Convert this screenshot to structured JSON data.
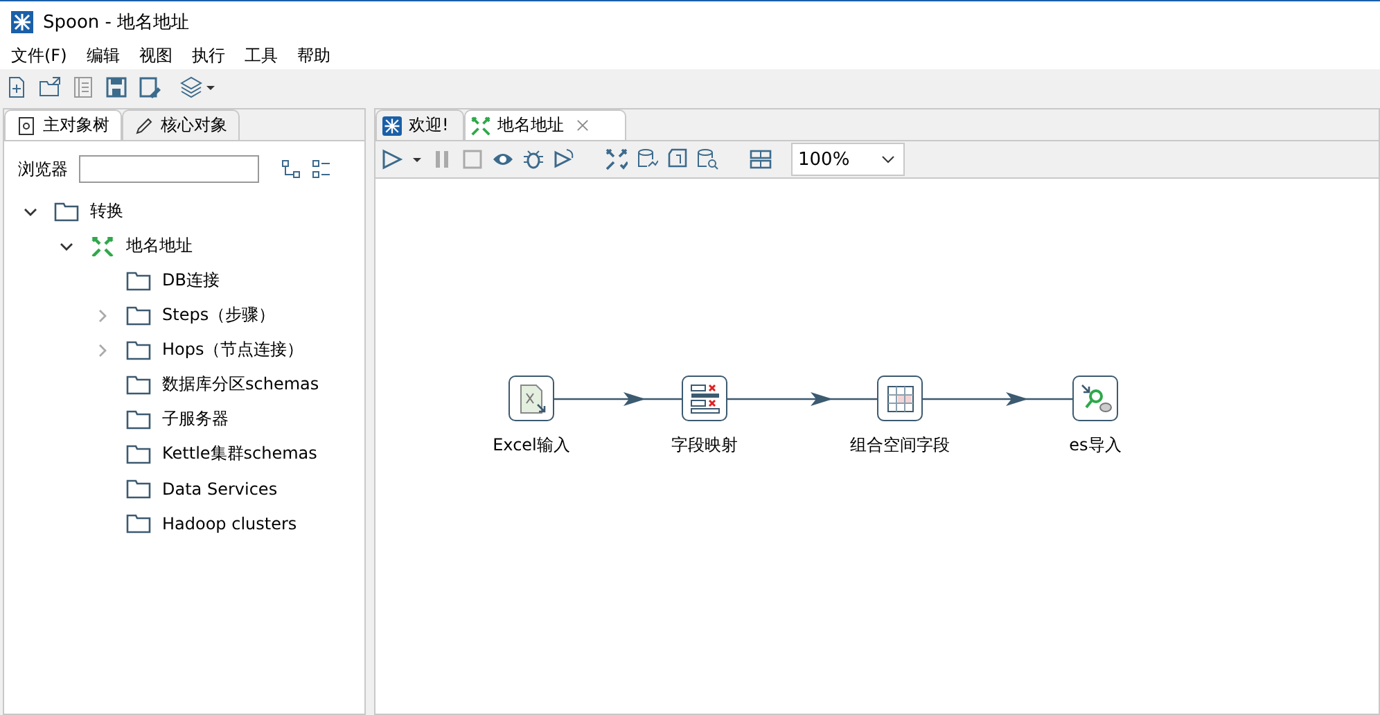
{
  "window": {
    "title": "Spoon - 地名地址"
  },
  "menu": [
    "文件(F)",
    "编辑",
    "视图",
    "执行",
    "工具",
    "帮助"
  ],
  "left_tabs": [
    {
      "label": "主对象树",
      "selected": true
    },
    {
      "label": "核心对象",
      "selected": false
    }
  ],
  "browser": {
    "label": "浏览器"
  },
  "tree": [
    {
      "label": "转换",
      "kind": "folder",
      "expanded": true,
      "children": [
        {
          "label": "地名地址",
          "kind": "transformation",
          "expanded": true,
          "children": [
            {
              "label": "DB连接",
              "kind": "folder"
            },
            {
              "label": "Steps（步骤）",
              "kind": "folder",
              "expanded": false
            },
            {
              "label": "Hops（节点连接）",
              "kind": "folder",
              "expanded": false
            },
            {
              "label": "数据库分区schemas",
              "kind": "folder"
            },
            {
              "label": "子服务器",
              "kind": "folder"
            },
            {
              "label": "Kettle集群schemas",
              "kind": "folder"
            },
            {
              "label": "Data Services",
              "kind": "folder"
            },
            {
              "label": "Hadoop clusters",
              "kind": "folder"
            }
          ]
        }
      ]
    }
  ],
  "editor_tabs": [
    {
      "label": "欢迎!",
      "kind": "welcome",
      "selected": false
    },
    {
      "label": "地名地址",
      "kind": "transformation",
      "selected": true,
      "closable": true
    }
  ],
  "zoom": {
    "value": "100%"
  },
  "steps": [
    {
      "label": "Excel输入",
      "kind": "excel"
    },
    {
      "label": "字段映射",
      "kind": "mapping"
    },
    {
      "label": "组合空间字段",
      "kind": "grid"
    },
    {
      "label": "es导入",
      "kind": "search"
    }
  ]
}
